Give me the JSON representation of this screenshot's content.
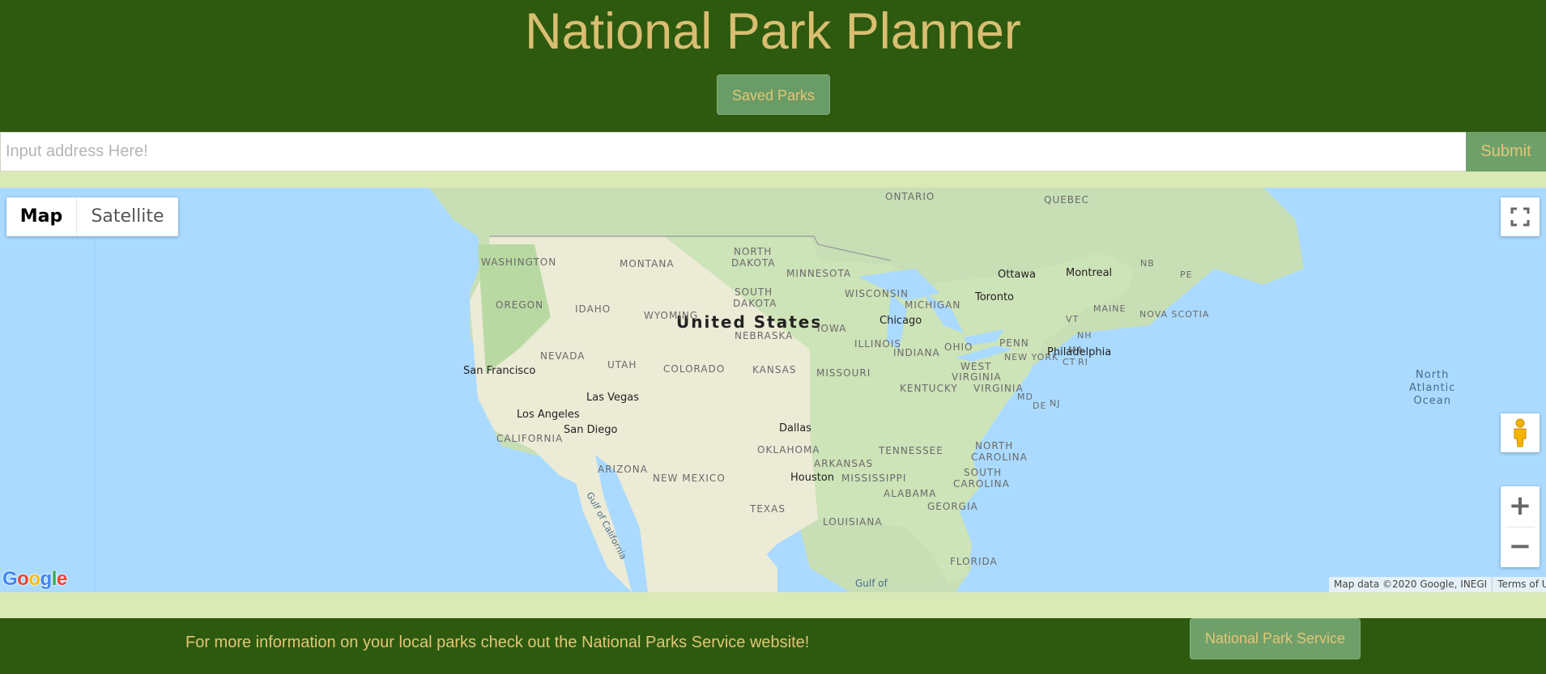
{
  "header": {
    "title": "National Park Planner",
    "saved_parks_label": "Saved Parks"
  },
  "search": {
    "placeholder": "Input address Here!",
    "value": "",
    "submit_label": "Submit"
  },
  "map": {
    "map_type_options": [
      "Map",
      "Satellite"
    ],
    "selected_map_type": "Map",
    "zoom_in": "+",
    "zoom_out": "−",
    "logo_text": "Google",
    "attribution": "Map data ©2020 Google, INEGI",
    "terms": "Terms of Use",
    "country_label": "United States",
    "ocean_label": [
      "North",
      "Atlantic",
      "Ocean"
    ],
    "gulf_california": "Gulf of California",
    "gulf_mexico": "Gulf of",
    "regions": [
      "ONTARIO",
      "QUEBEC",
      "WASHINGTON",
      "MONTANA",
      "NORTH",
      "DAKOTA",
      "MINNESOTA",
      "OREGON",
      "IDAHO",
      "SOUTH",
      "DAKOTA",
      "WYOMING",
      "WISCONSIN",
      "MICHIGAN",
      "NEBRASKA",
      "IOWA",
      "ILLINOIS",
      "OHIO",
      "PENN",
      "NEVADA",
      "UTAH",
      "COLORADO",
      "KANSAS",
      "MISSOURI",
      "INDIANA",
      "WEST",
      "VIRGINIA",
      "KENTUCKY",
      "VIRGINIA",
      "CALIFORNIA",
      "ARIZONA",
      "OKLAHOMA",
      "TENNESSEE",
      "NORTH",
      "CAROLINA",
      "ARKANSAS",
      "NEW MEXICO",
      "MISSISSIPPI",
      "SOUTH",
      "CAROLINA",
      "ALABAMA",
      "GEORGIA",
      "TEXAS",
      "LOUISIANA",
      "FLORIDA",
      "NEW YORK",
      "VT",
      "NH",
      "MA",
      "CT",
      "RI",
      "MAINE",
      "NOVA SCOTIA",
      "NB",
      "PE",
      "MD",
      "DE",
      "NJ"
    ],
    "cities": [
      "Ottawa",
      "Montreal",
      "Toronto",
      "Chicago",
      "Philadelphia",
      "San Francisco",
      "Las Vegas",
      "Los Angeles",
      "San Diego",
      "Dallas",
      "Houston"
    ]
  },
  "footer": {
    "text": "For more information on your local parks check out the National Parks Service website!",
    "nps_button_label": "National Park Service"
  },
  "colors": {
    "header_bg": "#2d5a0e",
    "title": "#d9be72",
    "button_bg": "#6fa06a",
    "band": "#dbe9b6",
    "ocean": "#aadaff"
  }
}
